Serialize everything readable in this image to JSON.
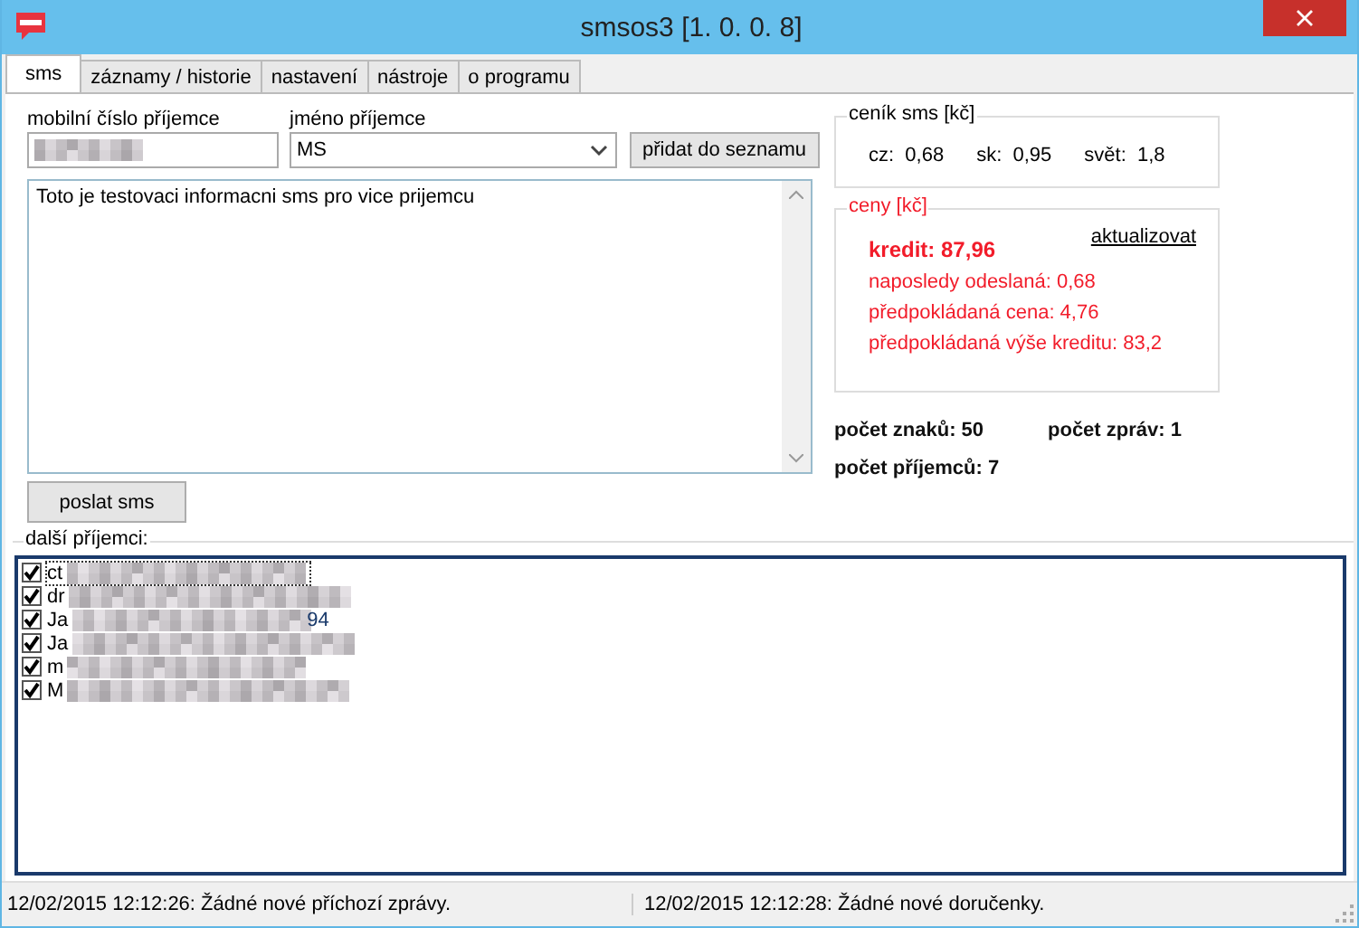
{
  "window": {
    "title": "smsos3 [1. 0. 0. 8]"
  },
  "tabs": [
    {
      "label": "sms",
      "selected": true
    },
    {
      "label": "záznamy / historie",
      "selected": false
    },
    {
      "label": "nastavení",
      "selected": false
    },
    {
      "label": "nástroje",
      "selected": false
    },
    {
      "label": "o programu",
      "selected": false
    }
  ],
  "form": {
    "phone_label": "mobilní číslo příjemce",
    "name_label": "jméno příjemce",
    "name_value": "MS",
    "add_button": "přidat do seznamu",
    "message": "Toto je testovaci informacni sms pro vice prijemcu",
    "send_button": "poslat sms"
  },
  "pricelist": {
    "title": "ceník sms [kč]",
    "items": [
      {
        "label": "cz:",
        "value": "0,68"
      },
      {
        "label": "sk:",
        "value": "0,95"
      },
      {
        "label": "svět:",
        "value": "1,8"
      }
    ]
  },
  "prices": {
    "title": "ceny [kč]",
    "update_link": "aktualizovat",
    "credit": "kredit:  87,96",
    "lines": [
      "naposledy odeslaná:  0,68",
      "předpokládaná cena:  4,76",
      "předpokládaná výše kreditu:  83,2"
    ]
  },
  "counts": {
    "chars": "počet znaků: 50",
    "messages": "počet zpráv: 1",
    "recipients": "počet příjemců: 7"
  },
  "recipients": {
    "title": "další příjemci:",
    "items": [
      {
        "text": "ct",
        "checked": true,
        "focused": true
      },
      {
        "text": "dr",
        "checked": true,
        "focused": false
      },
      {
        "text": "Ja",
        "tail": "94",
        "checked": true,
        "focused": false
      },
      {
        "text": "Ja",
        "checked": true,
        "focused": false
      },
      {
        "text": "m",
        "checked": true,
        "focused": false
      },
      {
        "text": "M",
        "checked": true,
        "focused": false
      }
    ]
  },
  "status_bar": [
    "12/02/2015 12:12:26: Žádné nové příchozí zprávy.",
    "12/02/2015 12:12:28: Žádné nové doručenky."
  ]
}
